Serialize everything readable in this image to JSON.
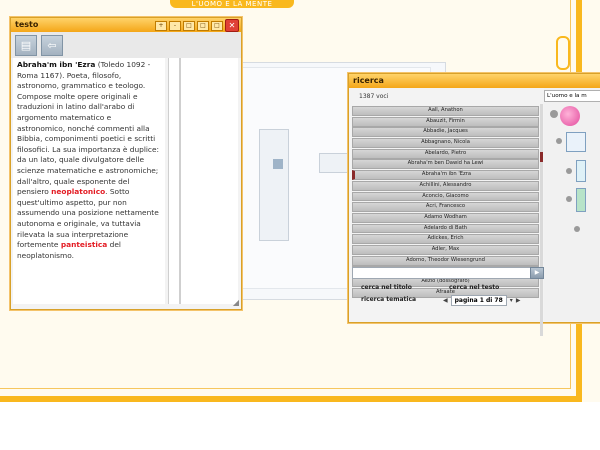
{
  "background": {
    "top_tab_text": "L'UOMO E LA MENTE"
  },
  "testo": {
    "title": "testo",
    "controls": [
      "+",
      "-",
      "□",
      "□",
      "□"
    ],
    "text": {
      "name": "Abraha'm ibn 'Ezra",
      "p1": " (Toledo 1092 - Roma 1167). Poeta, filosofo, astronomo, grammatico e teologo. Compose molte opere originali e traduzioni in latino dall'arabo di argomento matematico e astronomico, nonché commenti alla Bibbia, componimenti poetici e scritti filosofici. La sua importanza è duplice: da un lato, quale divulgatore delle scienze matematiche e astronomiche; dall'altro, quale esponente del pensiero ",
      "kw1": "neoplatonico",
      "p2": ". Sotto quest'ultimo aspetto, pur non assumendo una posizione nettamente autonoma e originale, va tuttavia rilevata la sua interpretazione fortemente ",
      "kw2": "panteistica",
      "p3": " del neoplatonismo."
    }
  },
  "ricerca": {
    "title": "ricerca",
    "count": "1387 voci",
    "items": [
      "Aall, Anathon",
      "Abauzit, Firmin",
      "Abbadie, Jacques",
      "Abbagnano, Nicola",
      "Abelardo, Pietro",
      "Abraha'm ben Dawid ha Lewi",
      "Abraha'm ibn 'Ezra",
      "Achillini, Alessandro",
      "Aconcio, Giacomo",
      "Acri, Francesco",
      "Adamo Wodham",
      "Adelardo di Bath",
      "Adickes, Erich",
      "Adler, Max",
      "Adorno, Theodor Wiesengrund",
      "Adrasto di Afrodisiade",
      "Aezio (dossografo)",
      "Afraate"
    ],
    "search_placeholder": "",
    "options": {
      "title": "cerca nel titolo",
      "text": "cerca nel testo",
      "thematic": "ricerca tematica"
    },
    "pager": "pagina 1 di 78",
    "right_title": "L'uomo e la m"
  }
}
